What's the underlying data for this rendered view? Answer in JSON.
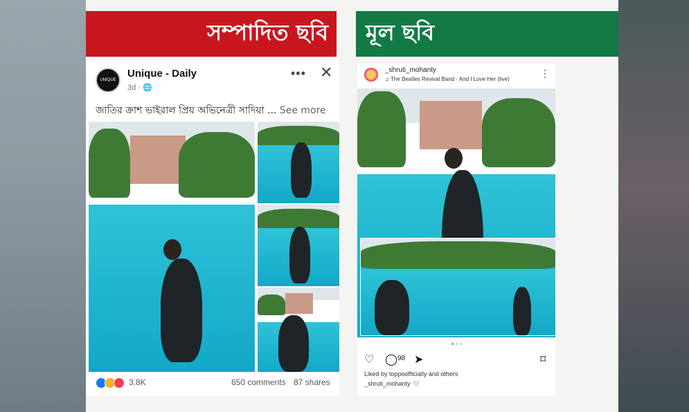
{
  "banners": {
    "edited_label": "সম্পাদিত ছবি",
    "original_label": "মূল ছবি",
    "edited_color": "#c8161e",
    "original_color": "#137a46"
  },
  "facebook_post": {
    "page_name": "Unique - Daily",
    "avatar_text": "UNIQUE",
    "timestamp": "3d",
    "privacy_icon": "globe-icon",
    "caption": "জাতির ক্রাশ ভাইরাল প্রিয় অভিনেত্রী সাদিয়া ...",
    "see_more": "See more",
    "reaction_count": "3.8K",
    "comments": "650 comments",
    "shares": "87 shares"
  },
  "instagram_post": {
    "username": "_shruti_mohanty",
    "song": "The Beatles Revival Band · And I Love Her (live)",
    "comment_count": "98",
    "liked_by": "Liked by toppoofficially and others",
    "caption_user": "_shruti_mohanty",
    "caption_emoji": "🤍"
  }
}
